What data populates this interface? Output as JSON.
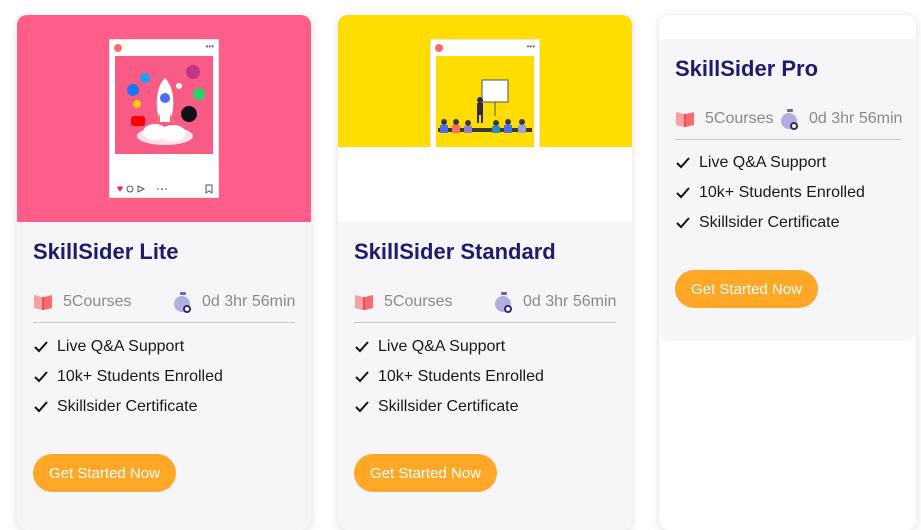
{
  "cards": [
    {
      "title": "SkillSider Lite",
      "courses": "5Courses",
      "duration": "0d 3hr 56min",
      "features": [
        "Live Q&A Support",
        "10k+ Students Enrolled",
        "Skillsider Certificate"
      ],
      "cta": "Get Started Now",
      "banner_color": "#ff5e8a"
    },
    {
      "title": "SkillSider Standard",
      "courses": "5Courses",
      "duration": "0d 3hr 56min",
      "features": [
        "Live Q&A Support",
        "10k+ Students Enrolled",
        "Skillsider Certificate"
      ],
      "cta": "Get Started Now",
      "banner_color": "#ffdd00"
    },
    {
      "title": "SkillSider Pro",
      "courses": "5Courses",
      "duration": "0d 3hr 56min",
      "features": [
        "Live Q&A Support",
        "10k+ Students Enrolled",
        "Skillsider Certificate"
      ],
      "cta": "Get Started Now"
    }
  ],
  "colors": {
    "title": "#1e1a6e",
    "cta": "#ffa726",
    "card_bg": "#f6f6f8",
    "meta_text": "#8a8a8a"
  },
  "icons": {
    "courses": "open-book-icon",
    "duration": "stopwatch-icon",
    "feature": "check-icon"
  }
}
